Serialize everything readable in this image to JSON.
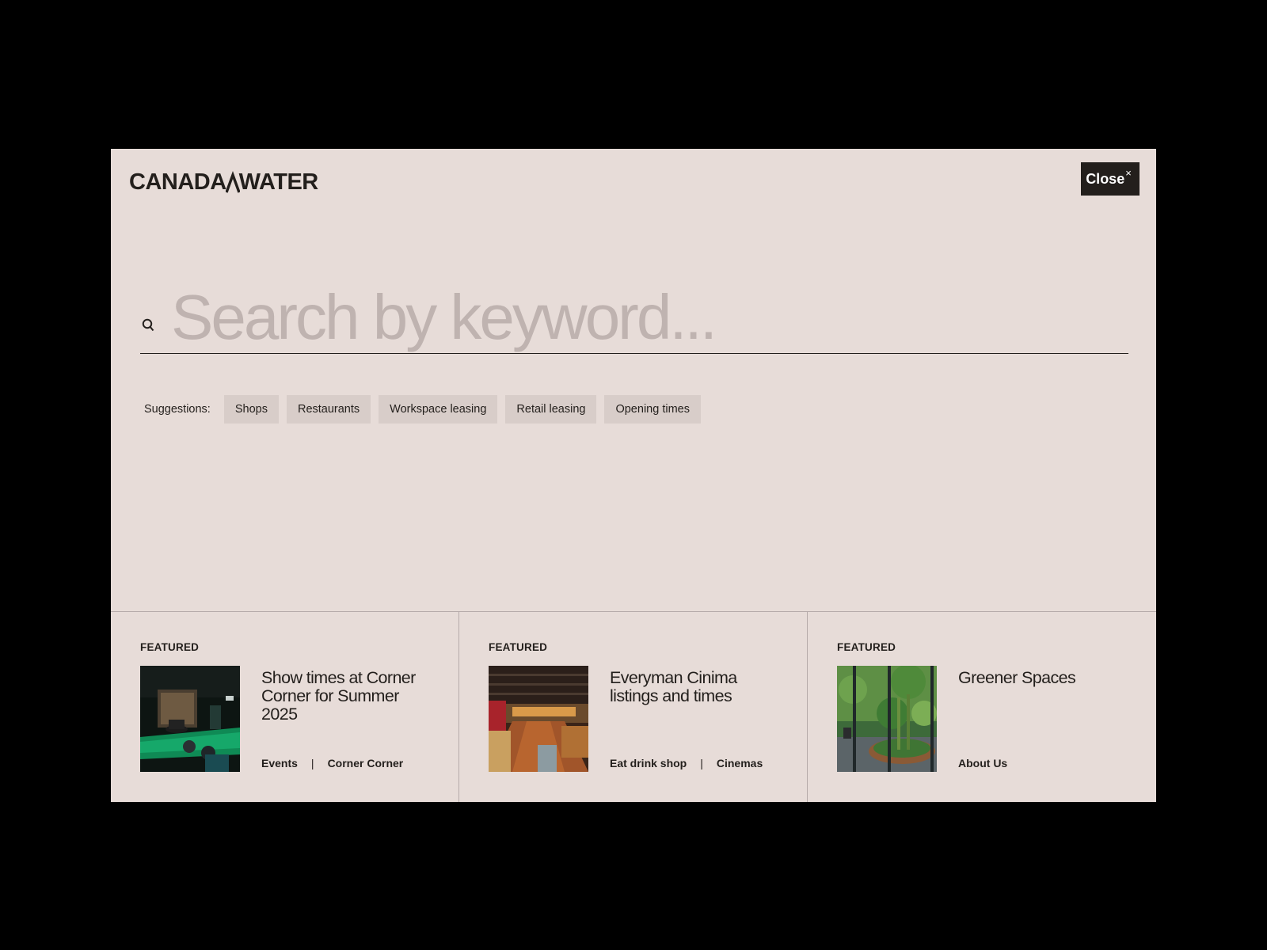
{
  "header": {
    "logo_text_left": "CANADA",
    "logo_text_right": "WATER",
    "close_label": "Close",
    "close_icon": "×"
  },
  "search": {
    "placeholder": "Search by keyword...",
    "value": ""
  },
  "suggestions": {
    "label": "Suggestions:",
    "items": [
      "Shops",
      "Restaurants",
      "Workspace leasing",
      "Retail leasing",
      "Opening times"
    ]
  },
  "featured": [
    {
      "label": "FEATURED",
      "title": "Show times at Corner Corner for Summer 2025",
      "tags": [
        "Events",
        "Corner Corner"
      ]
    },
    {
      "label": "FEATURED",
      "title": "Everyman Cinima listings and times",
      "tags": [
        "Eat drink shop",
        "Cinemas"
      ]
    },
    {
      "label": "FEATURED",
      "title": "Greener Spaces",
      "tags": [
        "About Us"
      ]
    }
  ],
  "colors": {
    "background": "#000000",
    "panel": "#e7dcd8",
    "chip": "#d8cdc9",
    "text": "#231f1c",
    "placeholder": "#bfb3b0"
  }
}
